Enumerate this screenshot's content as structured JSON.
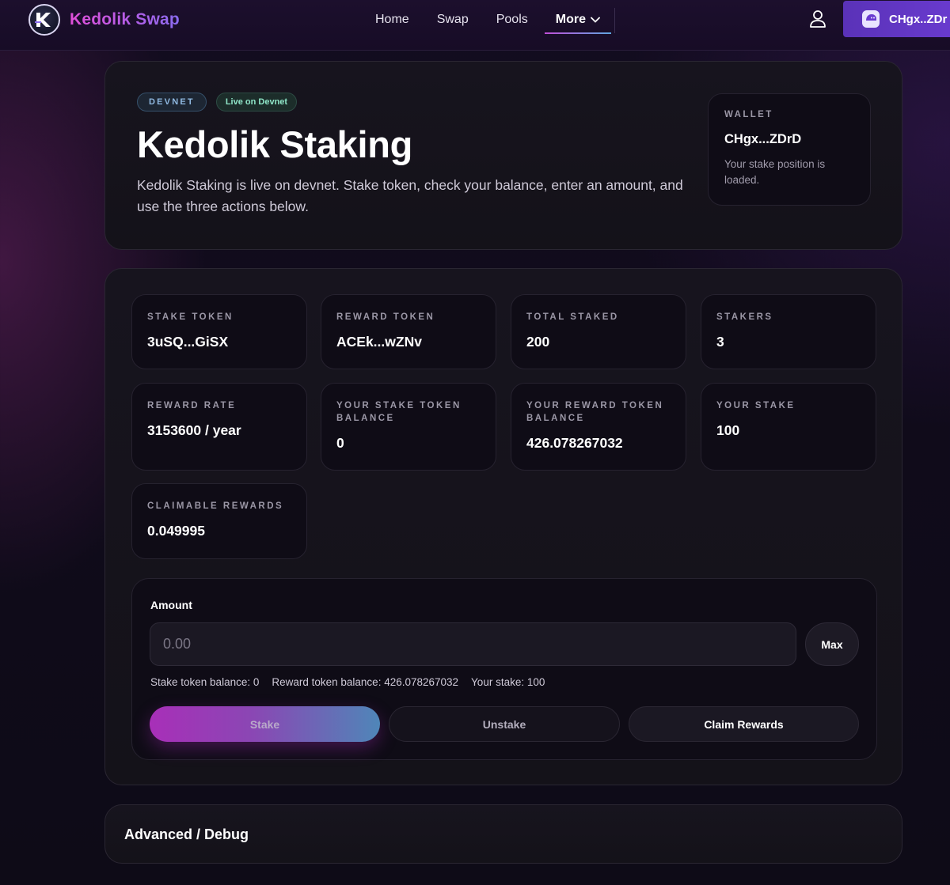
{
  "nav": {
    "brand": "Kedolik Swap",
    "links": [
      "Home",
      "Swap",
      "Pools"
    ],
    "more_label": "More",
    "wallet_label": "CHgx..ZDr"
  },
  "hero": {
    "badge_network": "DEVNET",
    "badge_status": "Live on Devnet",
    "title": "Kedolik Staking",
    "description": "Kedolik Staking is live on devnet. Stake token, check your balance, enter an amount, and use the three actions below.",
    "wallet": {
      "label": "WALLET",
      "address": "CHgx...ZDrD",
      "note": "Your stake position is loaded."
    }
  },
  "stats": {
    "stake_token": {
      "label": "STAKE TOKEN",
      "value": "3uSQ...GiSX"
    },
    "reward_token": {
      "label": "REWARD TOKEN",
      "value": "ACEk...wZNv"
    },
    "total_staked": {
      "label": "TOTAL STAKED",
      "value": "200"
    },
    "stakers": {
      "label": "STAKERS",
      "value": "3"
    },
    "reward_rate": {
      "label": "REWARD RATE",
      "value": "3153600 / year"
    },
    "your_stake_balance": {
      "label": "YOUR STAKE TOKEN BALANCE",
      "value": "0"
    },
    "your_reward_balance": {
      "label": "YOUR REWARD TOKEN BALANCE",
      "value": "426.078267032"
    },
    "your_stake": {
      "label": "YOUR STAKE",
      "value": "100"
    },
    "claimable": {
      "label": "CLAIMABLE REWARDS",
      "value": "0.049995"
    }
  },
  "action": {
    "amount_label": "Amount",
    "amount_placeholder": "0.00",
    "amount_value": "",
    "max_label": "Max",
    "stake_balance_text": "Stake token balance: 0",
    "reward_balance_text": "Reward token balance: 426.078267032",
    "your_stake_text": "Your stake: 100",
    "stake_label": "Stake",
    "unstake_label": "Unstake",
    "claim_label": "Claim Rewards"
  },
  "advanced": {
    "title": "Advanced / Debug"
  },
  "icons": {
    "logo": "kedolik-logo-icon",
    "more": "chevron-down-icon",
    "user": "user-icon",
    "wallet": "phantom-wallet-icon"
  },
  "colors": {
    "accent_purple": "#6a3bd0",
    "brand_gradient_start": "#e04fd8",
    "stake_gradient_start": "#a82fb8",
    "stake_gradient_end": "#4f86b8"
  }
}
